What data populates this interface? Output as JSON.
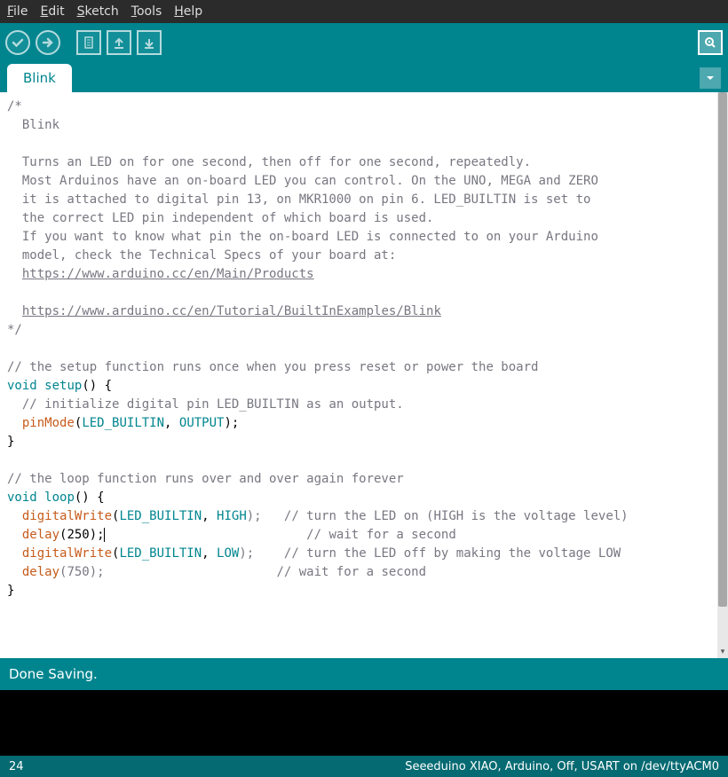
{
  "menu": {
    "file": "File",
    "edit": "Edit",
    "sketch": "Sketch",
    "tools": "Tools",
    "help": "Help"
  },
  "tabs": {
    "active": "Blink"
  },
  "code": {
    "l1": "/*",
    "l2": "  Blink",
    "l3": "",
    "l4": "  Turns an LED on for one second, then off for one second, repeatedly.",
    "l5": "  Most Arduinos have an on-board LED you can control. On the UNO, MEGA and ZERO",
    "l6": "  it is attached to digital pin 13, on MKR1000 on pin 6. LED_BUILTIN is set to",
    "l7": "  the correct LED pin independent of which board is used.",
    "l8": "  If you want to know what pin the on-board LED is connected to on your Arduino",
    "l9": "  model, check the Technical Specs of your board at:",
    "l10": "  ",
    "link1": "https://www.arduino.cc/en/Main/Products",
    "l11": "",
    "l12": "  ",
    "link2": "https://www.arduino.cc/en/Tutorial/BuiltInExamples/Blink",
    "l13": "*/",
    "l14": "",
    "c1": "// the setup function runs once when you press reset or power the board",
    "kw_void": "void",
    "fn_setup": "setup",
    "paren_open_brace": "() {",
    "c2": "  // initialize digital pin LED_BUILTIN as an output.",
    "fn_pinMode": "pinMode",
    "const_LED": "LED_BUILTIN",
    "comma_sp": ", ",
    "const_OUTPUT": "OUTPUT",
    "close_stmt": ");",
    "brace_close": "}",
    "c3": "// the loop function runs over and over again forever",
    "fn_loop": "loop",
    "fn_digitalWrite": "digitalWrite",
    "const_HIGH": "HIGH",
    "tail_on": ");   // turn the LED on (HIGH is the voltage level)",
    "fn_delay": "delay",
    "delay_250": "(250);",
    "wait1": "                           // wait for a second",
    "const_LOW": "LOW",
    "tail_off": ");    // turn the LED off by making the voltage LOW",
    "delay_750": "(750);                       // wait for a second",
    "open_paren": "("
  },
  "status": {
    "message": "Done Saving."
  },
  "footer": {
    "line": "24",
    "board": "Seeeduino XIAO, Arduino, Off, USART on /dev/ttyACM0"
  }
}
